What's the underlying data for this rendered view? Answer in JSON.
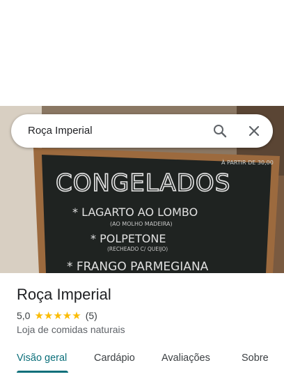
{
  "search": {
    "query": "Roça Imperial"
  },
  "photo": {
    "board_heading": "CONGELADOS",
    "board_note": "À PARTIR DE 30,00",
    "board_lines": [
      {
        "main": "* LAGARTO AO LOMBO",
        "sub": "(AO MOLHO MADEIRA)"
      },
      {
        "main": "* POLPETONE",
        "sub": "(RECHEADO C/ QUEIJO)"
      },
      {
        "main": "* FRANGO PARMEGIANA",
        "sub": ""
      }
    ]
  },
  "place": {
    "name": "Roça Imperial",
    "rating": "5,0",
    "stars": "★★★★★",
    "review_count": "(5)",
    "category": "Loja de comidas naturais"
  },
  "tabs": [
    {
      "label": "Visão geral"
    },
    {
      "label": "Cardápio"
    },
    {
      "label": "Avaliações"
    },
    {
      "label": "Sobre"
    }
  ],
  "colors": {
    "accent": "#0b6f7a",
    "star": "#fbbc04"
  }
}
